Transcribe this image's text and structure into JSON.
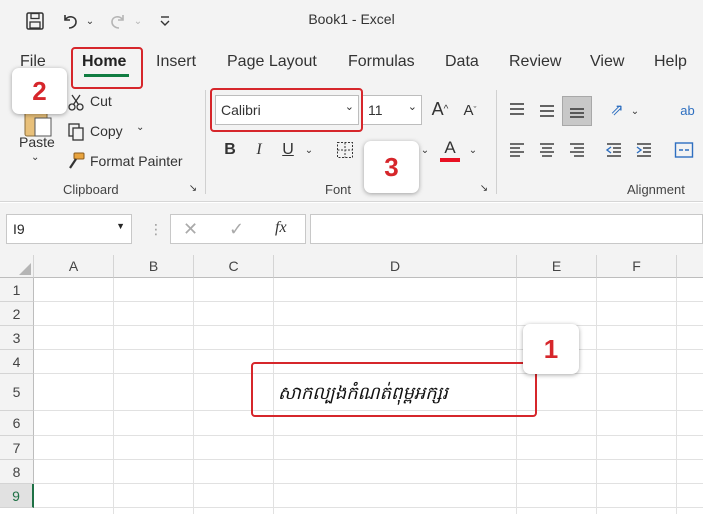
{
  "window": {
    "title": "Book1  -  Excel",
    "save_icon": "save-icon",
    "undo_icon": "undo-icon",
    "redo_icon": "redo-icon",
    "customize_icon": "customize-quick-access-icon"
  },
  "tabs": [
    "File",
    "Home",
    "Insert",
    "Page Layout",
    "Formulas",
    "Data",
    "Review",
    "View",
    "Help"
  ],
  "clipboard": {
    "paste_label": "Paste",
    "cut_label": "Cut",
    "copy_label": "Copy",
    "format_painter_label": "Format Painter",
    "group_label": "Clipboard"
  },
  "font": {
    "font_name": "Calibri",
    "font_size": "11",
    "group_label": "Font",
    "bold": "B",
    "italic": "I",
    "underline": "U",
    "font_color_glyph": "A",
    "font_color": "#e81123"
  },
  "alignment": {
    "group_label": "Alignment"
  },
  "formula_bar": {
    "name_box": "I9",
    "fx_label": "fx",
    "formula_value": ""
  },
  "grid": {
    "columns": [
      "A",
      "B",
      "C",
      "D",
      "E",
      "F"
    ],
    "rows": [
      "1",
      "2",
      "3",
      "4",
      "5",
      "6",
      "7",
      "8",
      "9"
    ],
    "selected_row": "9",
    "cell_d5_text": "សាកល្បងកំណត់ពុម្ពអក្សរ"
  },
  "annotations": {
    "badge_1": "1",
    "badge_2": "2",
    "badge_3": "3",
    "highlight_color": "#d6262b"
  }
}
